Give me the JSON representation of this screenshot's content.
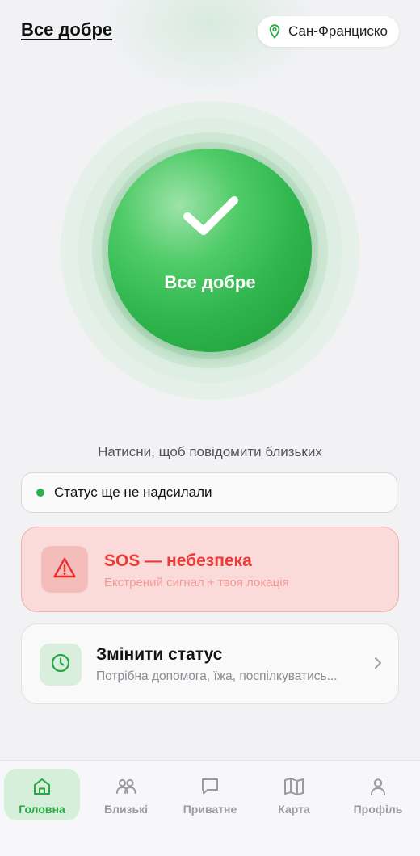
{
  "header": {
    "title": "Все добре",
    "location": "Сан-Франциско",
    "location_icon": "map-pin-icon"
  },
  "status_button": {
    "label": "Все добре",
    "icon": "check-icon",
    "color": "#2fb64d"
  },
  "hint": "Натисни, щоб повідомити близьких",
  "status_pill": {
    "text": "Статус ще не надсилали",
    "dot_color": "#2db34a"
  },
  "sos": {
    "title": "SOS — небезпека",
    "subtitle": "Екстрений сигнал + твоя локація",
    "icon": "warning-triangle-icon",
    "color": "#ee3a36"
  },
  "change_status": {
    "title": "Змінити статус",
    "subtitle": "Потрібна допомога, їжа, поспілкуватись...",
    "icon": "clock-icon"
  },
  "tabs": [
    {
      "label": "Головна",
      "icon": "home-icon",
      "active": true
    },
    {
      "label": "Близькі",
      "icon": "people-icon",
      "active": false
    },
    {
      "label": "Приватне",
      "icon": "chat-bubble-icon",
      "active": false
    },
    {
      "label": "Карта",
      "icon": "map-icon",
      "active": false
    },
    {
      "label": "Профіль",
      "icon": "person-icon",
      "active": false
    }
  ],
  "colors": {
    "accent_green": "#26a744",
    "danger_red": "#ee3a36",
    "background": "#f2f2f5"
  }
}
